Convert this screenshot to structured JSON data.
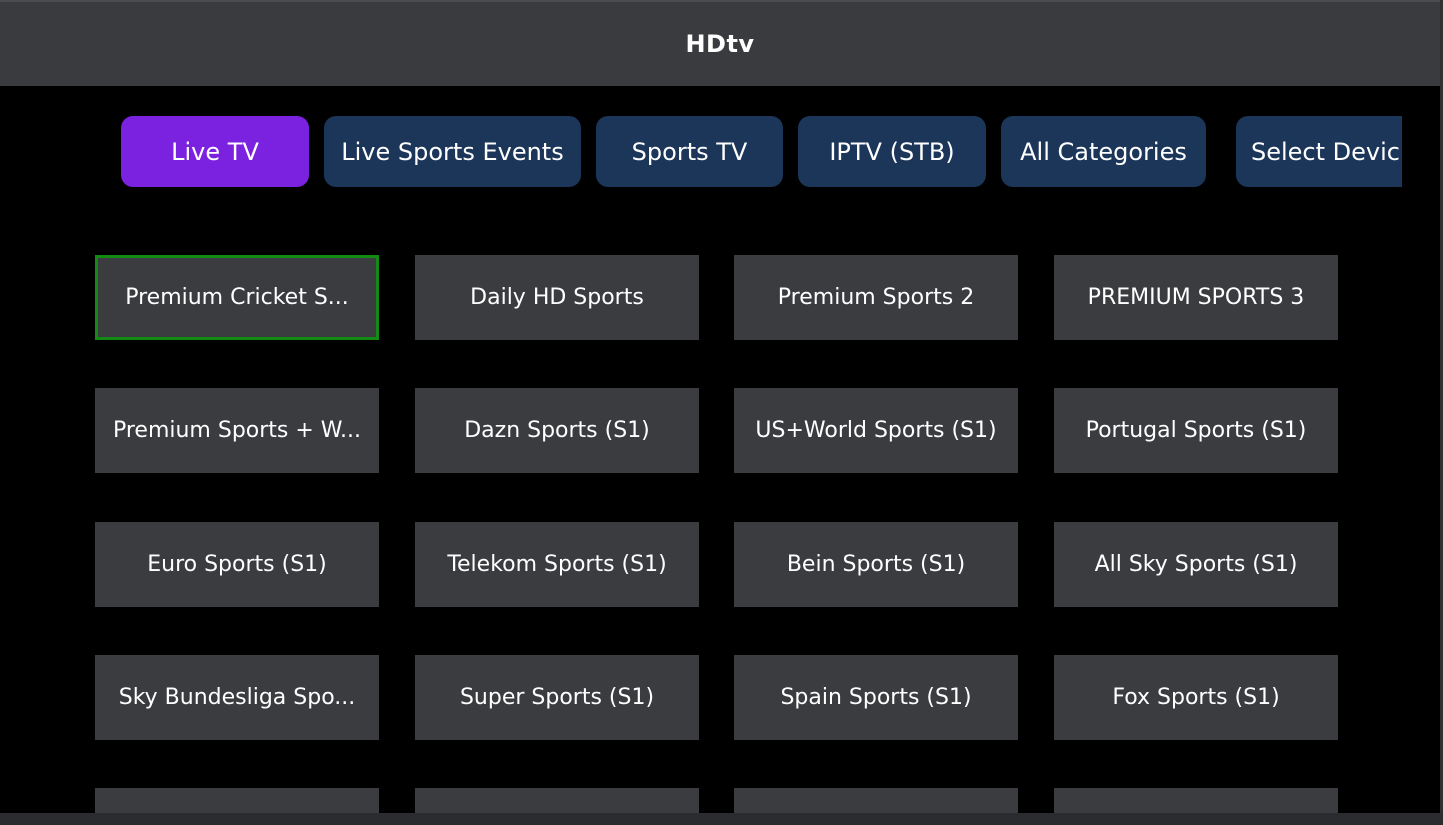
{
  "header": {
    "title": "HDtv"
  },
  "tabs": [
    {
      "label": "Live TV",
      "active": true
    },
    {
      "label": "Live Sports Events",
      "active": false
    },
    {
      "label": "Sports TV",
      "active": false
    },
    {
      "label": "IPTV (STB)",
      "active": false
    },
    {
      "label": "All Categories",
      "active": false
    },
    {
      "label": "Select Devic",
      "active": false
    }
  ],
  "channels": [
    {
      "label": "Premium Cricket S...",
      "focused": true
    },
    {
      "label": "Daily HD Sports"
    },
    {
      "label": "Premium Sports 2"
    },
    {
      "label": "PREMIUM SPORTS 3"
    },
    {
      "label": "Premium Sports + W..."
    },
    {
      "label": "Dazn Sports (S1)"
    },
    {
      "label": "US+World Sports (S1)"
    },
    {
      "label": "Portugal Sports (S1)"
    },
    {
      "label": "Euro Sports (S1)"
    },
    {
      "label": "Telekom Sports (S1)"
    },
    {
      "label": "Bein Sports (S1)"
    },
    {
      "label": "All Sky Sports (S1)"
    },
    {
      "label": "Sky Bundesliga Spo..."
    },
    {
      "label": "Super Sports (S1)"
    },
    {
      "label": "Spain Sports (S1)"
    },
    {
      "label": "Fox Sports (S1)"
    }
  ],
  "colors": {
    "active_tab": "#7b22e0",
    "tab": "#1c3659",
    "cell": "#3a3c40",
    "focus_border": "#138a13",
    "header": "#393b3f"
  }
}
